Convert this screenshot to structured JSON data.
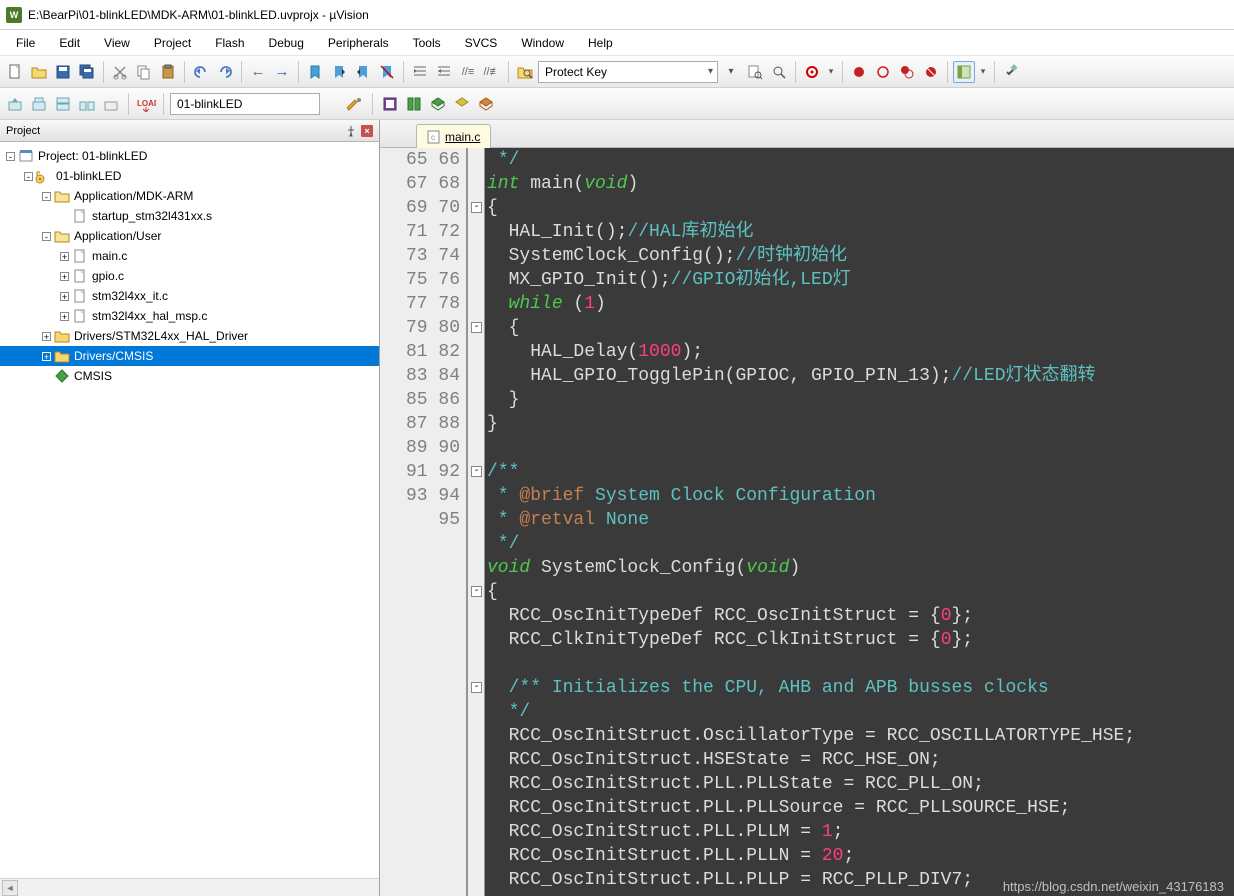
{
  "window": {
    "title": "E:\\BearPi\\01-blinkLED\\MDK-ARM\\01-blinkLED.uvprojx - µVision",
    "app_abbrev": "W"
  },
  "menu": [
    "File",
    "Edit",
    "View",
    "Project",
    "Flash",
    "Debug",
    "Peripherals",
    "Tools",
    "SVCS",
    "Window",
    "Help"
  ],
  "toolbar": {
    "combo_right": "Protect Key"
  },
  "toolbar2": {
    "target": "01-blinkLED"
  },
  "project_panel": {
    "title": "Project",
    "tree": {
      "root": "Project: 01-blinkLED",
      "target": "01-blinkLED",
      "groups": [
        {
          "name": "Application/MDK-ARM",
          "expanded": true,
          "files": [
            "startup_stm32l431xx.s"
          ]
        },
        {
          "name": "Application/User",
          "expanded": true,
          "files": [
            "main.c",
            "gpio.c",
            "stm32l4xx_it.c",
            "stm32l4xx_hal_msp.c"
          ]
        },
        {
          "name": "Drivers/STM32L4xx_HAL_Driver",
          "expanded": false,
          "files": []
        },
        {
          "name": "Drivers/CMSIS",
          "expanded": false,
          "selected": true,
          "files": []
        },
        {
          "name": "CMSIS",
          "expanded": false,
          "files": [],
          "icon": "diamond"
        }
      ]
    }
  },
  "editor": {
    "active_tab": "main.c",
    "first_line": 65,
    "code_lines": [
      {
        "n": 65,
        "html": " <span class='comment'>*/</span>"
      },
      {
        "n": 66,
        "html": "<span class='type'>int</span> main(<span class='type'>void</span>)"
      },
      {
        "n": 67,
        "html": "{",
        "fold": "open"
      },
      {
        "n": 68,
        "html": "  HAL_Init();<span class='comment'>//HAL库初始化</span>"
      },
      {
        "n": 69,
        "html": "  SystemClock_Config();<span class='comment'>//时钟初始化</span>"
      },
      {
        "n": 70,
        "html": "  MX_GPIO_Init();<span class='comment'>//GPIO初始化,LED灯</span>"
      },
      {
        "n": 71,
        "html": "  <span class='kw'>while</span> (<span class='num'>1</span>)"
      },
      {
        "n": 72,
        "html": "  {",
        "fold": "open"
      },
      {
        "n": 73,
        "html": "    HAL_Delay(<span class='num'>1000</span>);"
      },
      {
        "n": 74,
        "html": "    HAL_GPIO_TogglePin(GPIOC, GPIO_PIN_13);<span class='comment'>//LED灯状态翻转</span>"
      },
      {
        "n": 75,
        "html": "  }"
      },
      {
        "n": 76,
        "html": "}"
      },
      {
        "n": 77,
        "html": ""
      },
      {
        "n": 78,
        "html": "<span class='comment'>/**</span>",
        "fold": "open"
      },
      {
        "n": 79,
        "html": "<span class='comment'> * <span class='commentkw'>@brief</span> System Clock Configuration</span>"
      },
      {
        "n": 80,
        "html": "<span class='comment'> * <span class='commentkw'>@retval</span> None</span>"
      },
      {
        "n": 81,
        "html": "<span class='comment'> */</span>"
      },
      {
        "n": 82,
        "html": "<span class='type'>void</span> SystemClock_Config(<span class='type'>void</span>)"
      },
      {
        "n": 83,
        "html": "{",
        "fold": "open"
      },
      {
        "n": 84,
        "html": "  RCC_OscInitTypeDef RCC_OscInitStruct = {<span class='num'>0</span>};"
      },
      {
        "n": 85,
        "html": "  RCC_ClkInitTypeDef RCC_ClkInitStruct = {<span class='num'>0</span>};"
      },
      {
        "n": 86,
        "html": ""
      },
      {
        "n": 87,
        "html": "  <span class='comment'>/** Initializes the CPU, AHB and APB busses clocks</span>",
        "fold": "open"
      },
      {
        "n": 88,
        "html": "  <span class='comment'>*/</span>"
      },
      {
        "n": 89,
        "html": "  RCC_OscInitStruct.OscillatorType = RCC_OSCILLATORTYPE_HSE;"
      },
      {
        "n": 90,
        "html": "  RCC_OscInitStruct.HSEState = RCC_HSE_ON;"
      },
      {
        "n": 91,
        "html": "  RCC_OscInitStruct.PLL.PLLState = RCC_PLL_ON;"
      },
      {
        "n": 92,
        "html": "  RCC_OscInitStruct.PLL.PLLSource = RCC_PLLSOURCE_HSE;"
      },
      {
        "n": 93,
        "html": "  RCC_OscInitStruct.PLL.PLLM = <span class='num'>1</span>;"
      },
      {
        "n": 94,
        "html": "  RCC_OscInitStruct.PLL.PLLN = <span class='num'>20</span>;"
      },
      {
        "n": 95,
        "html": "  RCC_OscInitStruct.PLL.PLLP = RCC_PLLP_DIV7;"
      }
    ]
  },
  "watermark": "https://blog.csdn.net/weixin_43176183"
}
